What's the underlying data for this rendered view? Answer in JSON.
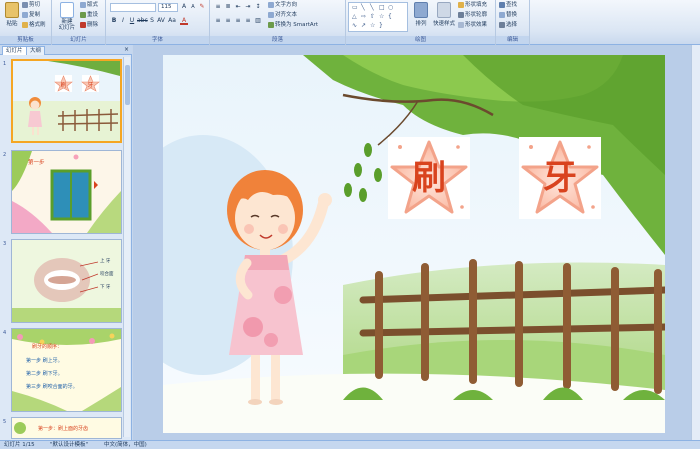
{
  "ribbon": {
    "groups": {
      "clipboard": "剪贴板",
      "slides": "幻灯片",
      "font": "字体",
      "paragraph": "段落",
      "drawing": "绘图",
      "editing": "编辑"
    },
    "paste": "粘贴",
    "cut": "剪切",
    "copy": "复制",
    "format_painter": "格式刷",
    "new_slide": "新建\n幻灯片",
    "layout": "版式",
    "reset": "重设",
    "delete": "删除",
    "font_size": "115",
    "text_direction": "文字方向",
    "align_text": "对齐文本",
    "convert_smartart": "转换为 SmartArt",
    "arrange": "排列",
    "quick_styles": "快速样式",
    "shape_fill": "形状填充",
    "shape_outline": "形状轮廓",
    "shape_effects": "形状效果",
    "find": "查找",
    "replace": "替换",
    "select": "选择"
  },
  "pane": {
    "tab_slides": "幻灯片",
    "tab_outline": "大纲",
    "close": "×",
    "thumbs": [
      {
        "num": "1"
      },
      {
        "num": "2",
        "caption": "第一步"
      },
      {
        "num": "3",
        "labels": [
          "上 牙",
          "咬合面",
          "下 牙"
        ]
      },
      {
        "num": "4",
        "lines": [
          "刷牙的顺序：",
          "第一步 刷上牙。",
          "第二步 刷下牙。",
          "第三步 刷咬合面的牙。"
        ]
      },
      {
        "num": "5",
        "caption": "第一步：刷上面的牙齿"
      }
    ]
  },
  "slide": {
    "char1": "刷",
    "char2": "牙"
  },
  "status": {
    "slide_info": "幻灯片 1/15",
    "theme": "\"默认设计模板\"",
    "language": "中文(简体，中国)"
  },
  "colors": {
    "accent": "#f5a623",
    "ribbon_bg": "#dbe6f4",
    "star_text": "#d9431e"
  }
}
